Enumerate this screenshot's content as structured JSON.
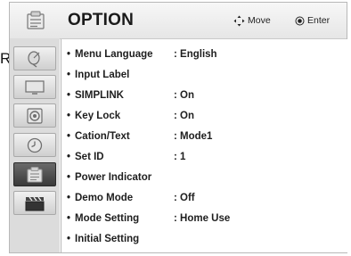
{
  "stray_text": "R.",
  "header": {
    "title": "OPTION",
    "hint_move": "Move",
    "hint_enter": "Enter"
  },
  "sidebar": {
    "items": [
      {
        "icon": "satellite-dish-icon"
      },
      {
        "icon": "screen-icon"
      },
      {
        "icon": "speaker-icon"
      },
      {
        "icon": "clock-icon"
      },
      {
        "icon": "option-lock-icon",
        "active": true
      },
      {
        "icon": "input-clapper-icon"
      }
    ]
  },
  "menu": {
    "bullet": "•",
    "items": [
      {
        "label": "Menu Language",
        "value": ": English"
      },
      {
        "label": "Input Label",
        "value": ""
      },
      {
        "label": "SIMPLINK",
        "value": ": On"
      },
      {
        "label": "Key Lock",
        "value": ": On"
      },
      {
        "label": "Cation/Text",
        "value": ": Mode1"
      },
      {
        "label": "Set ID",
        "value": ": 1"
      },
      {
        "label": "Power Indicator",
        "value": ""
      },
      {
        "label": "Demo Mode",
        "value": ": Off"
      },
      {
        "label": "Mode Setting",
        "value": ": Home Use"
      },
      {
        "label": "Initial Setting",
        "value": ""
      }
    ]
  },
  "colors": {
    "active_tab": "#444444",
    "sidebar_bg": "#dcdcdc",
    "header_bg": "#eeeeee"
  }
}
